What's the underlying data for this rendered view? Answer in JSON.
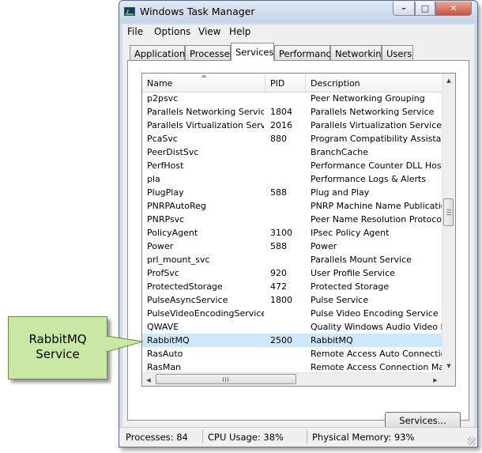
{
  "window": {
    "title": "Windows Task Manager",
    "minimize_glyph": "–",
    "maximize_glyph": "□",
    "close_glyph": "✕"
  },
  "menu": [
    {
      "label": "File",
      "name": "menu-file"
    },
    {
      "label": "Options",
      "name": "menu-options"
    },
    {
      "label": "View",
      "name": "menu-view"
    },
    {
      "label": "Help",
      "name": "menu-help"
    }
  ],
  "tabs": [
    {
      "label": "Applications",
      "name": "tab-applications",
      "active": false
    },
    {
      "label": "Processes",
      "name": "tab-processes",
      "active": false
    },
    {
      "label": "Services",
      "name": "tab-services",
      "active": true
    },
    {
      "label": "Performance",
      "name": "tab-performance",
      "active": false
    },
    {
      "label": "Networking",
      "name": "tab-networking",
      "active": false
    },
    {
      "label": "Users",
      "name": "tab-users",
      "active": false
    }
  ],
  "services_table": {
    "columns": [
      "Name",
      "PID",
      "Description"
    ],
    "sort_column": "Name",
    "rows": [
      {
        "name": "p2psvc",
        "pid": "",
        "description": "Peer Networking Grouping",
        "selected": false
      },
      {
        "name": "Parallels Networking Service",
        "pid": "1804",
        "description": "Parallels Networking Service",
        "selected": false
      },
      {
        "name": "Parallels Virtualization Service",
        "pid": "2016",
        "description": "Parallels Virtualization Service",
        "selected": false
      },
      {
        "name": "PcaSvc",
        "pid": "880",
        "description": "Program Compatibility Assistant Se",
        "selected": false
      },
      {
        "name": "PeerDistSvc",
        "pid": "",
        "description": "BranchCache",
        "selected": false
      },
      {
        "name": "PerfHost",
        "pid": "",
        "description": "Performance Counter DLL Host",
        "selected": false
      },
      {
        "name": "pla",
        "pid": "",
        "description": "Performance Logs & Alerts",
        "selected": false
      },
      {
        "name": "PlugPlay",
        "pid": "588",
        "description": "Plug and Play",
        "selected": false
      },
      {
        "name": "PNRPAutoReg",
        "pid": "",
        "description": "PNRP Machine Name Publication Se",
        "selected": false
      },
      {
        "name": "PNRPsvc",
        "pid": "",
        "description": "Peer Name Resolution Protocol",
        "selected": false
      },
      {
        "name": "PolicyAgent",
        "pid": "3100",
        "description": "IPsec Policy Agent",
        "selected": false
      },
      {
        "name": "Power",
        "pid": "588",
        "description": "Power",
        "selected": false
      },
      {
        "name": "prl_mount_svc",
        "pid": "",
        "description": "Parallels Mount Service",
        "selected": false
      },
      {
        "name": "ProfSvc",
        "pid": "920",
        "description": "User Profile Service",
        "selected": false
      },
      {
        "name": "ProtectedStorage",
        "pid": "472",
        "description": "Protected Storage",
        "selected": false
      },
      {
        "name": "PulseAsyncService",
        "pid": "1800",
        "description": "Pulse Service",
        "selected": false
      },
      {
        "name": "PulseVideoEncodingService",
        "pid": "",
        "description": "Pulse Video Encoding Service",
        "selected": false
      },
      {
        "name": "QWAVE",
        "pid": "",
        "description": "Quality Windows Audio Video Expe",
        "selected": false
      },
      {
        "name": "RabbitMQ",
        "pid": "2500",
        "description": "RabbitMQ",
        "selected": true
      },
      {
        "name": "RasAuto",
        "pid": "",
        "description": "Remote Access Auto Connection M",
        "selected": false
      },
      {
        "name": "RasMan",
        "pid": "",
        "description": "Remote Access Connection Manag",
        "selected": false
      }
    ]
  },
  "scrollbar": {
    "up_arrow": "▲",
    "down_arrow": "▼",
    "left_arrow": "◀",
    "right_arrow": "▶"
  },
  "services_button": {
    "label": "Services..."
  },
  "status": {
    "processes": "Processes: 84",
    "cpu": "CPU Usage: 38%",
    "memory": "Physical Memory: 93%"
  },
  "callout": {
    "line1": "RabbitMQ",
    "line2": "Service"
  },
  "colors": {
    "selected_row": "#cde8fc",
    "callout_fill": "#c9e8a3",
    "window_frame": "#cfdbe9"
  }
}
